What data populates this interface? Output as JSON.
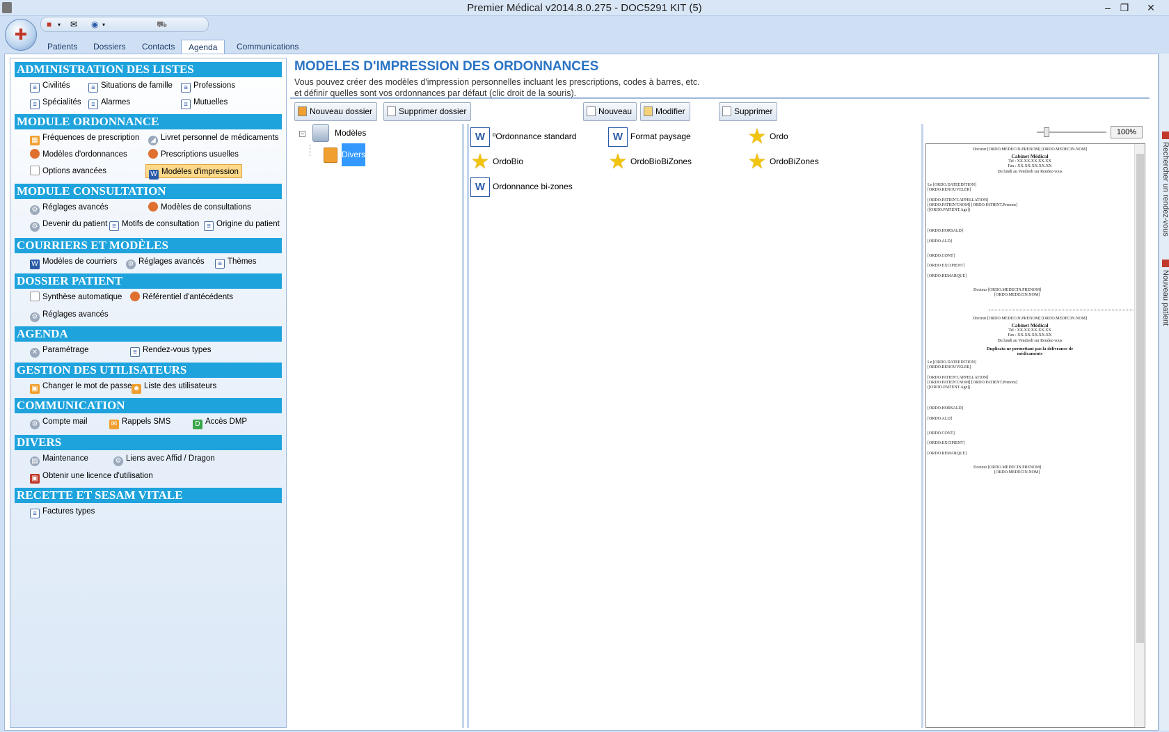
{
  "window": {
    "title": "Premier Médical v2014.8.0.275 - DOC5291 KIT (5)",
    "controls": [
      "–",
      "❐",
      "✕"
    ]
  },
  "tabs": [
    "Patients",
    "Dossiers",
    "Contacts",
    "Agenda",
    "Communications"
  ],
  "active_tab": "Agenda",
  "sections": {
    "admin": {
      "title": "ADMINISTRATION DES LISTES",
      "items": [
        "Civilités",
        "Situations de famille",
        "Professions",
        "Spécialités",
        "Alarmes",
        "Mutuelles"
      ]
    },
    "ordonnance": {
      "title": "MODULE ORDONNANCE",
      "items": [
        "Fréquences de prescription",
        "Livret personnel de médicaments",
        "Modèles d'ordonnances",
        "Prescriptions usuelles",
        "Options avancées",
        "Modèles d'impression"
      ]
    },
    "consultation": {
      "title": "MODULE CONSULTATION",
      "items": [
        "Réglages avancés",
        "Modèles de consultations",
        "Devenir du patient",
        "Motifs de consultation",
        "Origine du patient"
      ]
    },
    "courriers": {
      "title": "COURRIERS ET MODÈLES",
      "items": [
        "Modèles de courriers",
        "Réglages avancés",
        "Thèmes"
      ]
    },
    "dossier": {
      "title": "DOSSIER PATIENT",
      "items": [
        "Synthèse automatique",
        "Référentiel d'antécédents",
        "Réglages avancés"
      ]
    },
    "agenda": {
      "title": "AGENDA",
      "items": [
        "Paramétrage",
        "Rendez-vous types"
      ]
    },
    "users": {
      "title": "GESTION DES UTILISATEURS",
      "items": [
        "Changer le mot de passe",
        "Liste des utilisateurs"
      ]
    },
    "communication": {
      "title": "COMMUNICATION",
      "items": [
        "Compte mail",
        "Rappels SMS",
        "Accès DMP"
      ]
    },
    "divers": {
      "title": "DIVERS",
      "items": [
        "Maintenance",
        "Liens avec Affid / Dragon",
        "Obtenir une licence d'utilisation"
      ]
    },
    "recette": {
      "title": "RECETTE ET SESAM VITALE",
      "items": [
        "Factures types"
      ]
    }
  },
  "header": {
    "title": "MODELES D'IMPRESSION DES ORDONNANCES",
    "line1": "Vous pouvez créer des modèles d'impression personnelles incluant les prescriptions, codes à barres, etc.",
    "line2": "et définir quelles sont vos ordonnances par défaut (clic droit de la souris)."
  },
  "toolbar": {
    "new_folder": "Nouveau dossier",
    "delete_folder": "Supprimer dossier",
    "new": "Nouveau",
    "modify": "Modifier",
    "delete": "Supprimer"
  },
  "tree": {
    "root": "Modèles",
    "child": "Divers"
  },
  "models": [
    {
      "label": "ºOrdonnance standard",
      "icon": "word-doc-icon"
    },
    {
      "label": "Format paysage",
      "icon": "word-doc-icon"
    },
    {
      "label": "Ordo",
      "icon": "star-icon"
    },
    {
      "label": "OrdoBio",
      "icon": "star-icon"
    },
    {
      "label": "OrdoBioBiZones",
      "icon": "star-icon"
    },
    {
      "label": "OrdoBiZones",
      "icon": "star-icon"
    },
    {
      "label": "Ordonnance bi-zones",
      "icon": "word-doc-icon"
    }
  ],
  "preview": {
    "zoom": "100%",
    "doctor_header": "Docteur [ORDO.MEDECIN.PRENOM] [ORDO.MEDECIN.NOM]",
    "cabinet": "Cabinet Médical",
    "tel": "Tel : XX.XX.XX.XX.XX",
    "fax": "Fax : XX.XX.XX.XX.XX",
    "hours": "Du lundi au Vendredi sur Rendez-vous",
    "date": "Le [ORDO.DATEEDITION]",
    "renew": "[ORDO.RENOUVELER]",
    "appellation": "[ORDO.PATIENT.APPELLATION]",
    "patient_name": "[ORDO.PATIENT.NOM] [ORDO.PATIENT.Prenom]",
    "patient_age": "([ORDO.PATIENT.Age])",
    "hors_ald": "[ORDO.HORSALD]",
    "ald": "[ORDO.ALD]",
    "cont": "[ORDO.CONT]",
    "excipient": "[ORDO.EXCIPIENT]",
    "remarque": "[ORDO.REMARQUE]",
    "sign1": "Docteur [ORDO.MEDECIN.PRENOM]",
    "sign2": "[ORDO.MEDECIN.NOM]",
    "duplicata1": "Duplicata ne permettant pas la délivrance de",
    "duplicata2": "médicaments"
  },
  "side_tabs": [
    "Rechercher un rendez-vous",
    "Nouveau patient"
  ]
}
